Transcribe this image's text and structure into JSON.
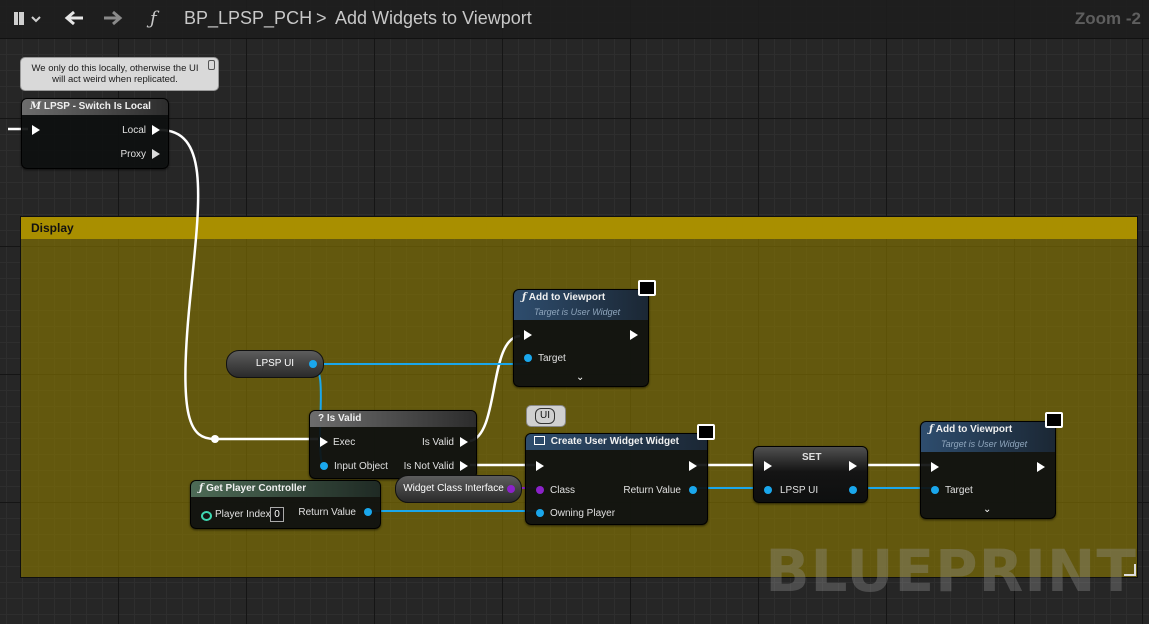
{
  "toolbar": {
    "bookmark_icon": "bookmark-icon",
    "back_icon": "arrow-left-icon",
    "forward_icon": "arrow-right-icon",
    "function_glyph": "ƒ",
    "blueprint_name": "BP_LPSP_PCH",
    "separator": ">",
    "graph_name": "Add Widgets to Viewport",
    "zoom": "Zoom -2"
  },
  "comment_bubble": {
    "text": "We only do this locally, otherwise the UI will act weird when replicated."
  },
  "comment_box": {
    "title": "Display"
  },
  "nodes": {
    "switch_local": {
      "title": "LPSP - Switch Is Local",
      "icon": "M",
      "pin_local": "Local",
      "pin_proxy": "Proxy"
    },
    "lpsp_ui_var": {
      "label": "LPSP UI"
    },
    "add_viewport_1": {
      "title": "Add to Viewport",
      "subtitle": "Target is User Widget",
      "pin_target": "Target"
    },
    "is_valid": {
      "title": "Is Valid",
      "icon": "?",
      "pin_exec": "Exec",
      "pin_input": "Input Object",
      "pin_valid": "Is Valid",
      "pin_not_valid": "Is Not Valid"
    },
    "ui_tag": {
      "label": "UI"
    },
    "create_widget": {
      "title": "Create User Widget Widget",
      "pin_class": "Class",
      "pin_return": "Return Value",
      "pin_owner": "Owning Player"
    },
    "widget_class_var": {
      "label": "Widget Class Interface"
    },
    "get_pc": {
      "title": "Get Player Controller",
      "pin_index": "Player Index",
      "index_value": "0",
      "pin_return": "Return Value"
    },
    "set_node": {
      "title": "SET",
      "pin_var": "LPSP UI"
    },
    "add_viewport_2": {
      "title": "Add to Viewport",
      "subtitle": "Target is User Widget",
      "pin_target": "Target"
    }
  },
  "watermark": "BLUEPRINT",
  "colors": {
    "exec_wire": "#ffffff",
    "object_wire": "#1aa7ec",
    "class_wire": "#8b22c9",
    "comment_fill": "#897800"
  }
}
